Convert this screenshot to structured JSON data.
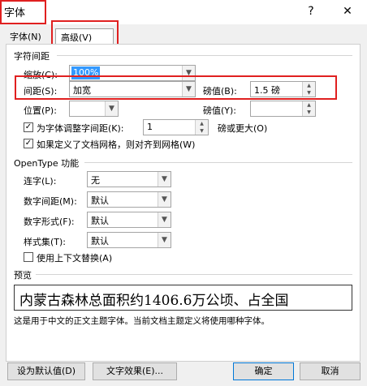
{
  "window": {
    "title": "字体",
    "help_glyph": "?",
    "close_glyph": "✕"
  },
  "tabs": [
    {
      "label": "字体(N)"
    },
    {
      "label": "高级(V)"
    }
  ],
  "char_spacing": {
    "section_title": "字符间距",
    "scale_label": "缩放(C):",
    "scale_value": "100%",
    "spacing_label": "间距(S):",
    "spacing_value": "加宽",
    "spacing_by_label": "磅值(B):",
    "spacing_by_value": "1.5 磅",
    "position_label": "位置(P):",
    "position_value": "",
    "position_by_label": "磅值(Y):",
    "position_by_value": "",
    "kerning_label": "为字体调整字间距(K):",
    "kerning_value": "1",
    "kerning_suffix": "磅或更大(O)",
    "kerning_checked": true,
    "grid_label": "如果定义了文档网格，则对齐到网格(W)",
    "grid_checked": true
  },
  "opentype": {
    "section_title": "OpenType 功能",
    "ligatures_label": "连字(L):",
    "ligatures_value": "无",
    "num_spacing_label": "数字间距(M):",
    "num_spacing_value": "默认",
    "num_forms_label": "数字形式(F):",
    "num_forms_value": "默认",
    "stylistic_label": "样式集(T):",
    "stylistic_value": "默认",
    "contextual_label": "使用上下文替换(A)",
    "contextual_checked": false
  },
  "preview": {
    "section_title": "预览",
    "sample_text": "内蒙古森林总面积约1406.6万公顷、占全国",
    "description": "这是用于中文的正文主题字体。当前文档主题定义将使用哪种字体。"
  },
  "buttons": {
    "set_default": "设为默认值(D)",
    "text_effects": "文字效果(E)...",
    "ok": "确定",
    "cancel": "取消"
  },
  "colors": {
    "highlight": "#e02020",
    "selection": "#3399ff"
  }
}
